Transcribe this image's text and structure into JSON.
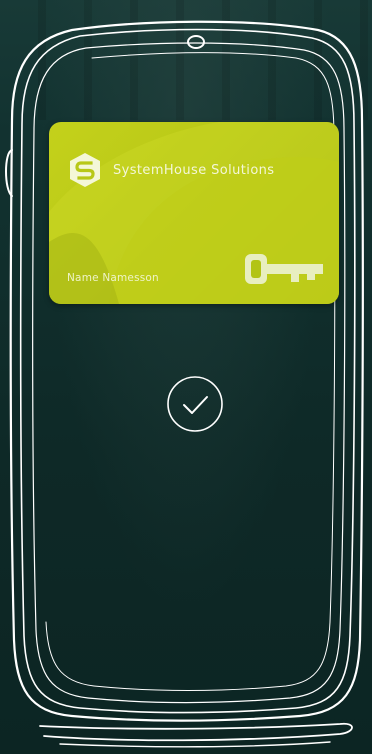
{
  "card": {
    "company_name": "SystemHouse Solutions",
    "holder_name": "Name Namesson",
    "logo_icon": "systemhouse-s-logo-icon",
    "key_icon": "key-icon"
  },
  "status": {
    "icon": "checkmark-circle-icon"
  },
  "colors": {
    "background": "#0f2a28",
    "card_lime": "#c4d11b",
    "sketch_line": "#ffffff"
  }
}
